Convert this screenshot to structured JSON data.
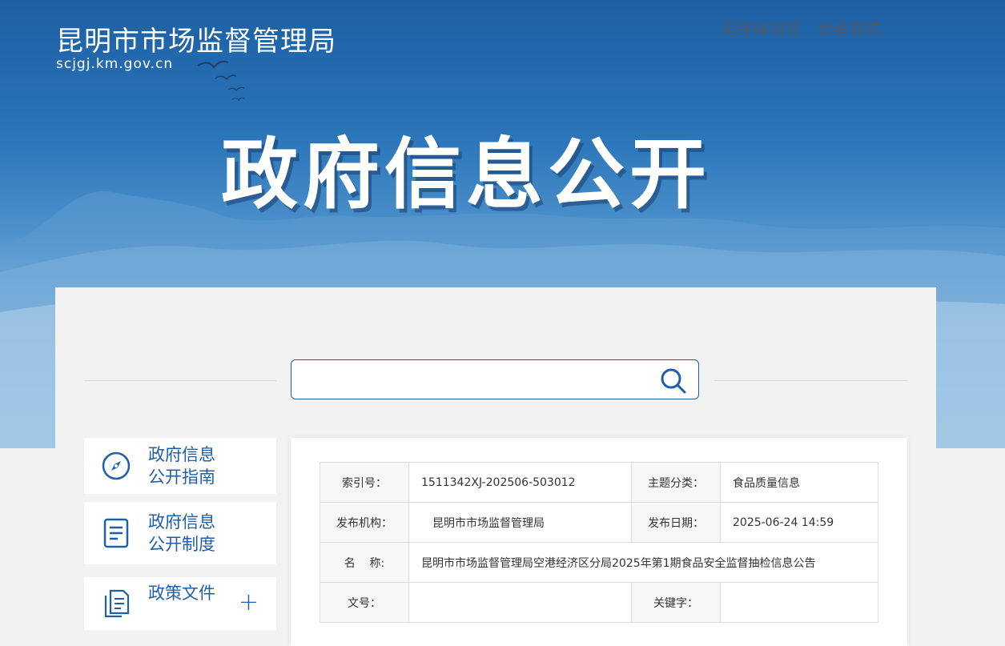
{
  "header": {
    "site_title": "昆明市市场监督管理局",
    "site_domain": "scjgj.km.gov.cn",
    "links": [
      "无障碍浏览",
      "长者模式"
    ],
    "banner_title": "政府信息公开"
  },
  "search": {
    "placeholder": ""
  },
  "sidebar": {
    "items": [
      {
        "label_line1": "政府信息",
        "label_line2": "公开指南",
        "icon": "compass-icon"
      },
      {
        "label_line1": "政府信息",
        "label_line2": "公开制度",
        "icon": "document-icon"
      },
      {
        "label_line1": "政策文件",
        "icon": "files-icon",
        "expand": "+"
      }
    ]
  },
  "meta": {
    "index_label": "索引号：",
    "index_value": "1511342XJ-202506-503012",
    "topic_label": "主题分类：",
    "topic_value": "食品质量信息",
    "publisher_label": "发布机构：",
    "publisher_value": "昆明市市场监督管理局",
    "date_label": "发布日期：",
    "date_value": "2025-06-24 14:59",
    "name_label": "名    称:",
    "name_value": "昆明市市场监督管理局空港经济区分局2025年第1期食品安全监督抽检信息公告",
    "docno_label": "文号：",
    "docno_value": "",
    "keyword_label": "关键字：",
    "keyword_value": ""
  }
}
